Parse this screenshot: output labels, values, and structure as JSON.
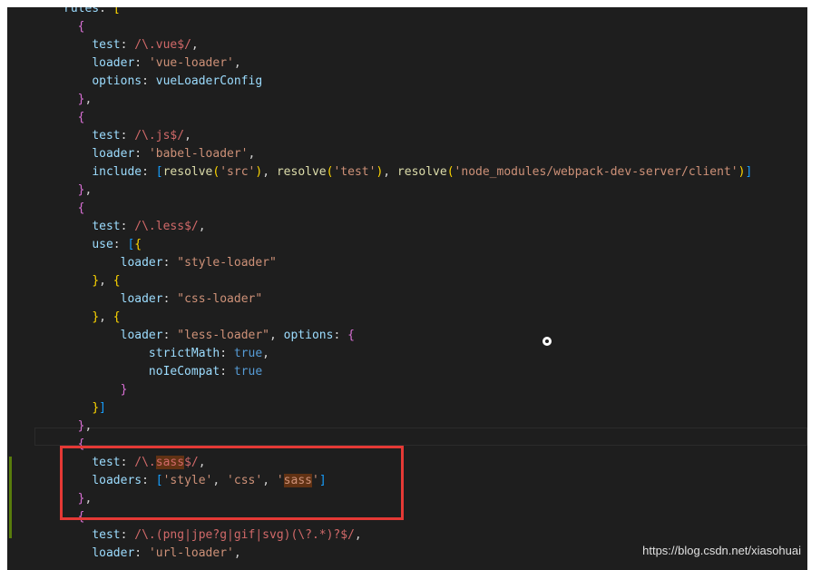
{
  "editor": {
    "lines": [
      [
        [
          "k",
          "rules"
        ],
        [
          "p",
          ": "
        ],
        [
          "b1",
          "["
        ]
      ],
      [
        [
          "p",
          "  "
        ],
        [
          "b2",
          "{"
        ]
      ],
      [
        [
          "p",
          "    "
        ],
        [
          "k",
          "test"
        ],
        [
          "p",
          ": "
        ],
        [
          "r",
          "/\\.vue$/"
        ],
        [
          "p",
          ","
        ]
      ],
      [
        [
          "p",
          "    "
        ],
        [
          "k",
          "loader"
        ],
        [
          "p",
          ": "
        ],
        [
          "s",
          "'vue-loader'"
        ],
        [
          "p",
          ","
        ]
      ],
      [
        [
          "p",
          "    "
        ],
        [
          "k",
          "options"
        ],
        [
          "p",
          ": "
        ],
        [
          "k",
          "vueLoaderConfig"
        ]
      ],
      [
        [
          "p",
          "  "
        ],
        [
          "b2",
          "}"
        ],
        [
          "p",
          ","
        ]
      ],
      [
        [
          "p",
          "  "
        ],
        [
          "b2",
          "{"
        ]
      ],
      [
        [
          "p",
          "    "
        ],
        [
          "k",
          "test"
        ],
        [
          "p",
          ": "
        ],
        [
          "r",
          "/\\.js$/"
        ],
        [
          "p",
          ","
        ]
      ],
      [
        [
          "p",
          "    "
        ],
        [
          "k",
          "loader"
        ],
        [
          "p",
          ": "
        ],
        [
          "s",
          "'babel-loader'"
        ],
        [
          "p",
          ","
        ]
      ],
      [
        [
          "p",
          "    "
        ],
        [
          "k",
          "include"
        ],
        [
          "p",
          ": "
        ],
        [
          "b3",
          "["
        ],
        [
          "f",
          "resolve"
        ],
        [
          "b1",
          "("
        ],
        [
          "s",
          "'src'"
        ],
        [
          "b1",
          ")"
        ],
        [
          "p",
          ", "
        ],
        [
          "f",
          "resolve"
        ],
        [
          "b1",
          "("
        ],
        [
          "s",
          "'test'"
        ],
        [
          "b1",
          ")"
        ],
        [
          "p",
          ", "
        ],
        [
          "f",
          "resolve"
        ],
        [
          "b1",
          "("
        ],
        [
          "s",
          "'node_modules/webpack-dev-server/client'"
        ],
        [
          "b1",
          ")"
        ],
        [
          "b3",
          "]"
        ]
      ],
      [
        [
          "p",
          "  "
        ],
        [
          "b2",
          "}"
        ],
        [
          "p",
          ","
        ]
      ],
      [
        [
          "p",
          "  "
        ],
        [
          "b2",
          "{"
        ]
      ],
      [
        [
          "p",
          "    "
        ],
        [
          "k",
          "test"
        ],
        [
          "p",
          ": "
        ],
        [
          "r",
          "/\\.less$/"
        ],
        [
          "p",
          ","
        ]
      ],
      [
        [
          "p",
          "    "
        ],
        [
          "k",
          "use"
        ],
        [
          "p",
          ": "
        ],
        [
          "b3",
          "["
        ],
        [
          "b1",
          "{"
        ]
      ],
      [
        [
          "p",
          "        "
        ],
        [
          "k",
          "loader"
        ],
        [
          "p",
          ": "
        ],
        [
          "s",
          "\"style-loader\""
        ]
      ],
      [
        [
          "p",
          "    "
        ],
        [
          "b1",
          "}"
        ],
        [
          "p",
          ", "
        ],
        [
          "b1",
          "{"
        ]
      ],
      [
        [
          "p",
          "        "
        ],
        [
          "k",
          "loader"
        ],
        [
          "p",
          ": "
        ],
        [
          "s",
          "\"css-loader\""
        ]
      ],
      [
        [
          "p",
          "    "
        ],
        [
          "b1",
          "}"
        ],
        [
          "p",
          ", "
        ],
        [
          "b1",
          "{"
        ]
      ],
      [
        [
          "p",
          "        "
        ],
        [
          "k",
          "loader"
        ],
        [
          "p",
          ": "
        ],
        [
          "s",
          "\"less-loader\""
        ],
        [
          "p",
          ", "
        ],
        [
          "k",
          "options"
        ],
        [
          "p",
          ": "
        ],
        [
          "b2",
          "{"
        ]
      ],
      [
        [
          "p",
          "            "
        ],
        [
          "k",
          "strictMath"
        ],
        [
          "p",
          ": "
        ],
        [
          "c",
          "true"
        ],
        [
          "p",
          ","
        ]
      ],
      [
        [
          "p",
          "            "
        ],
        [
          "k",
          "noIeCompat"
        ],
        [
          "p",
          ": "
        ],
        [
          "c",
          "true"
        ]
      ],
      [
        [
          "p",
          "        "
        ],
        [
          "b2",
          "}"
        ]
      ],
      [
        [
          "p",
          "    "
        ],
        [
          "b1",
          "}"
        ],
        [
          "b3",
          "]"
        ]
      ],
      [
        [
          "p",
          "  "
        ],
        [
          "b2",
          "}"
        ],
        [
          "p",
          ","
        ]
      ],
      [
        [
          "p",
          "  "
        ],
        [
          "b2",
          "{"
        ]
      ],
      [
        [
          "p",
          "    "
        ],
        [
          "k",
          "test"
        ],
        [
          "p",
          ": "
        ],
        [
          "r",
          "/\\."
        ],
        [
          "r hl",
          "sass"
        ],
        [
          "r",
          "$/"
        ],
        [
          "p",
          ","
        ]
      ],
      [
        [
          "p",
          "    "
        ],
        [
          "k",
          "loaders"
        ],
        [
          "p",
          ": "
        ],
        [
          "b3",
          "["
        ],
        [
          "s",
          "'style'"
        ],
        [
          "p",
          ", "
        ],
        [
          "s",
          "'css'"
        ],
        [
          "p",
          ", "
        ],
        [
          "s",
          "'"
        ],
        [
          "s hl",
          "sass"
        ],
        [
          "s",
          "'"
        ],
        [
          "b3",
          "]"
        ]
      ],
      [
        [
          "p",
          "  "
        ],
        [
          "b2",
          "}"
        ],
        [
          "p",
          ","
        ]
      ],
      [
        [
          "p",
          "  "
        ],
        [
          "b2",
          "{"
        ]
      ],
      [
        [
          "p",
          "    "
        ],
        [
          "k",
          "test"
        ],
        [
          "p",
          ": "
        ],
        [
          "r",
          "/\\.(png|jpe?g|gif|svg)(\\?.*)?$/"
        ],
        [
          "p",
          ","
        ]
      ],
      [
        [
          "p",
          "    "
        ],
        [
          "k",
          "loader"
        ],
        [
          "p",
          ": "
        ],
        [
          "s",
          "'url-loader'"
        ],
        [
          "p",
          ","
        ]
      ]
    ]
  },
  "watermark": "https://blog.csdn.net/xiasohuai"
}
